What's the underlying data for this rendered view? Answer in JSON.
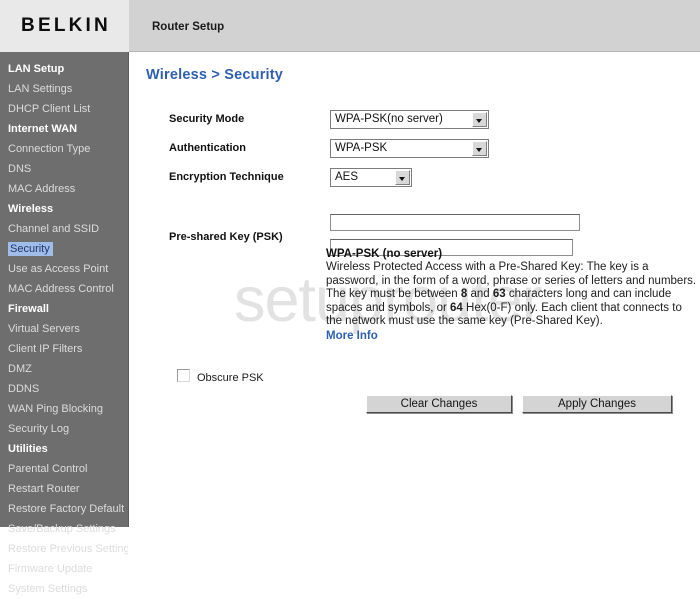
{
  "header": {
    "brand": "BELKIN",
    "app_title": "Router Setup"
  },
  "sidebar": {
    "items": [
      {
        "label": "LAN Setup",
        "type": "group"
      },
      {
        "label": "LAN Settings",
        "type": "link"
      },
      {
        "label": "DHCP Client List",
        "type": "link"
      },
      {
        "label": "Internet WAN",
        "type": "group"
      },
      {
        "label": "Connection Type",
        "type": "link"
      },
      {
        "label": "DNS",
        "type": "link"
      },
      {
        "label": "MAC Address",
        "type": "link"
      },
      {
        "label": "Wireless",
        "type": "group"
      },
      {
        "label": "Channel and SSID",
        "type": "link"
      },
      {
        "label": "Security",
        "type": "link",
        "selected": true
      },
      {
        "label": "Use as Access Point",
        "type": "link"
      },
      {
        "label": "MAC Address Control",
        "type": "link"
      },
      {
        "label": "Firewall",
        "type": "group"
      },
      {
        "label": "Virtual Servers",
        "type": "link"
      },
      {
        "label": "Client IP Filters",
        "type": "link"
      },
      {
        "label": "DMZ",
        "type": "link"
      },
      {
        "label": "DDNS",
        "type": "link"
      },
      {
        "label": "WAN Ping Blocking",
        "type": "link"
      },
      {
        "label": "Security Log",
        "type": "link"
      },
      {
        "label": "Utilities",
        "type": "group"
      },
      {
        "label": "Parental Control",
        "type": "link"
      },
      {
        "label": "Restart Router",
        "type": "link"
      },
      {
        "label": "Restore Factory Default",
        "type": "link"
      },
      {
        "label": "Save/Backup Settings",
        "type": "link"
      },
      {
        "label": "Restore Previous Settings",
        "type": "link"
      },
      {
        "label": "Firmware Update",
        "type": "link"
      },
      {
        "label": "System Settings",
        "type": "link"
      }
    ]
  },
  "main": {
    "breadcrumb": "Wireless > Security",
    "watermark": "setuprouter",
    "fields": {
      "security_mode": {
        "label": "Security Mode",
        "value": "WPA-PSK(no server)"
      },
      "authentication": {
        "label": "Authentication",
        "value": "WPA-PSK"
      },
      "encryption_technique": {
        "label": "Encryption Technique",
        "value": "AES"
      },
      "psk": {
        "label": "Pre-shared Key (PSK)",
        "value_1": "",
        "value_2": ""
      }
    },
    "description": {
      "heading": "WPA-PSK (no server)",
      "text_1": "Wireless Protected Access with a Pre-Shared Key: The key is a password, in the form of a word, phrase or series of letters and numbers. The key must be between ",
      "bold_1": "8",
      "text_2": " and ",
      "bold_2": "63",
      "text_3": " characters long and can include spaces and symbols, or ",
      "bold_3": "64",
      "text_4": " Hex(0-F) only. Each client that connects to the network must use the same key (Pre-Shared Key).",
      "more_info": "More Info"
    },
    "obscure_psk": {
      "label": "Obscure PSK",
      "checked": false
    },
    "buttons": {
      "clear": "Clear Changes",
      "apply": "Apply Changes"
    }
  },
  "colors": {
    "accent_blue": "#2f5fb0",
    "sidebar_bg": "#6e6e6e",
    "header_bg": "#d2d2d2",
    "selection_bg": "#9fbde8"
  }
}
